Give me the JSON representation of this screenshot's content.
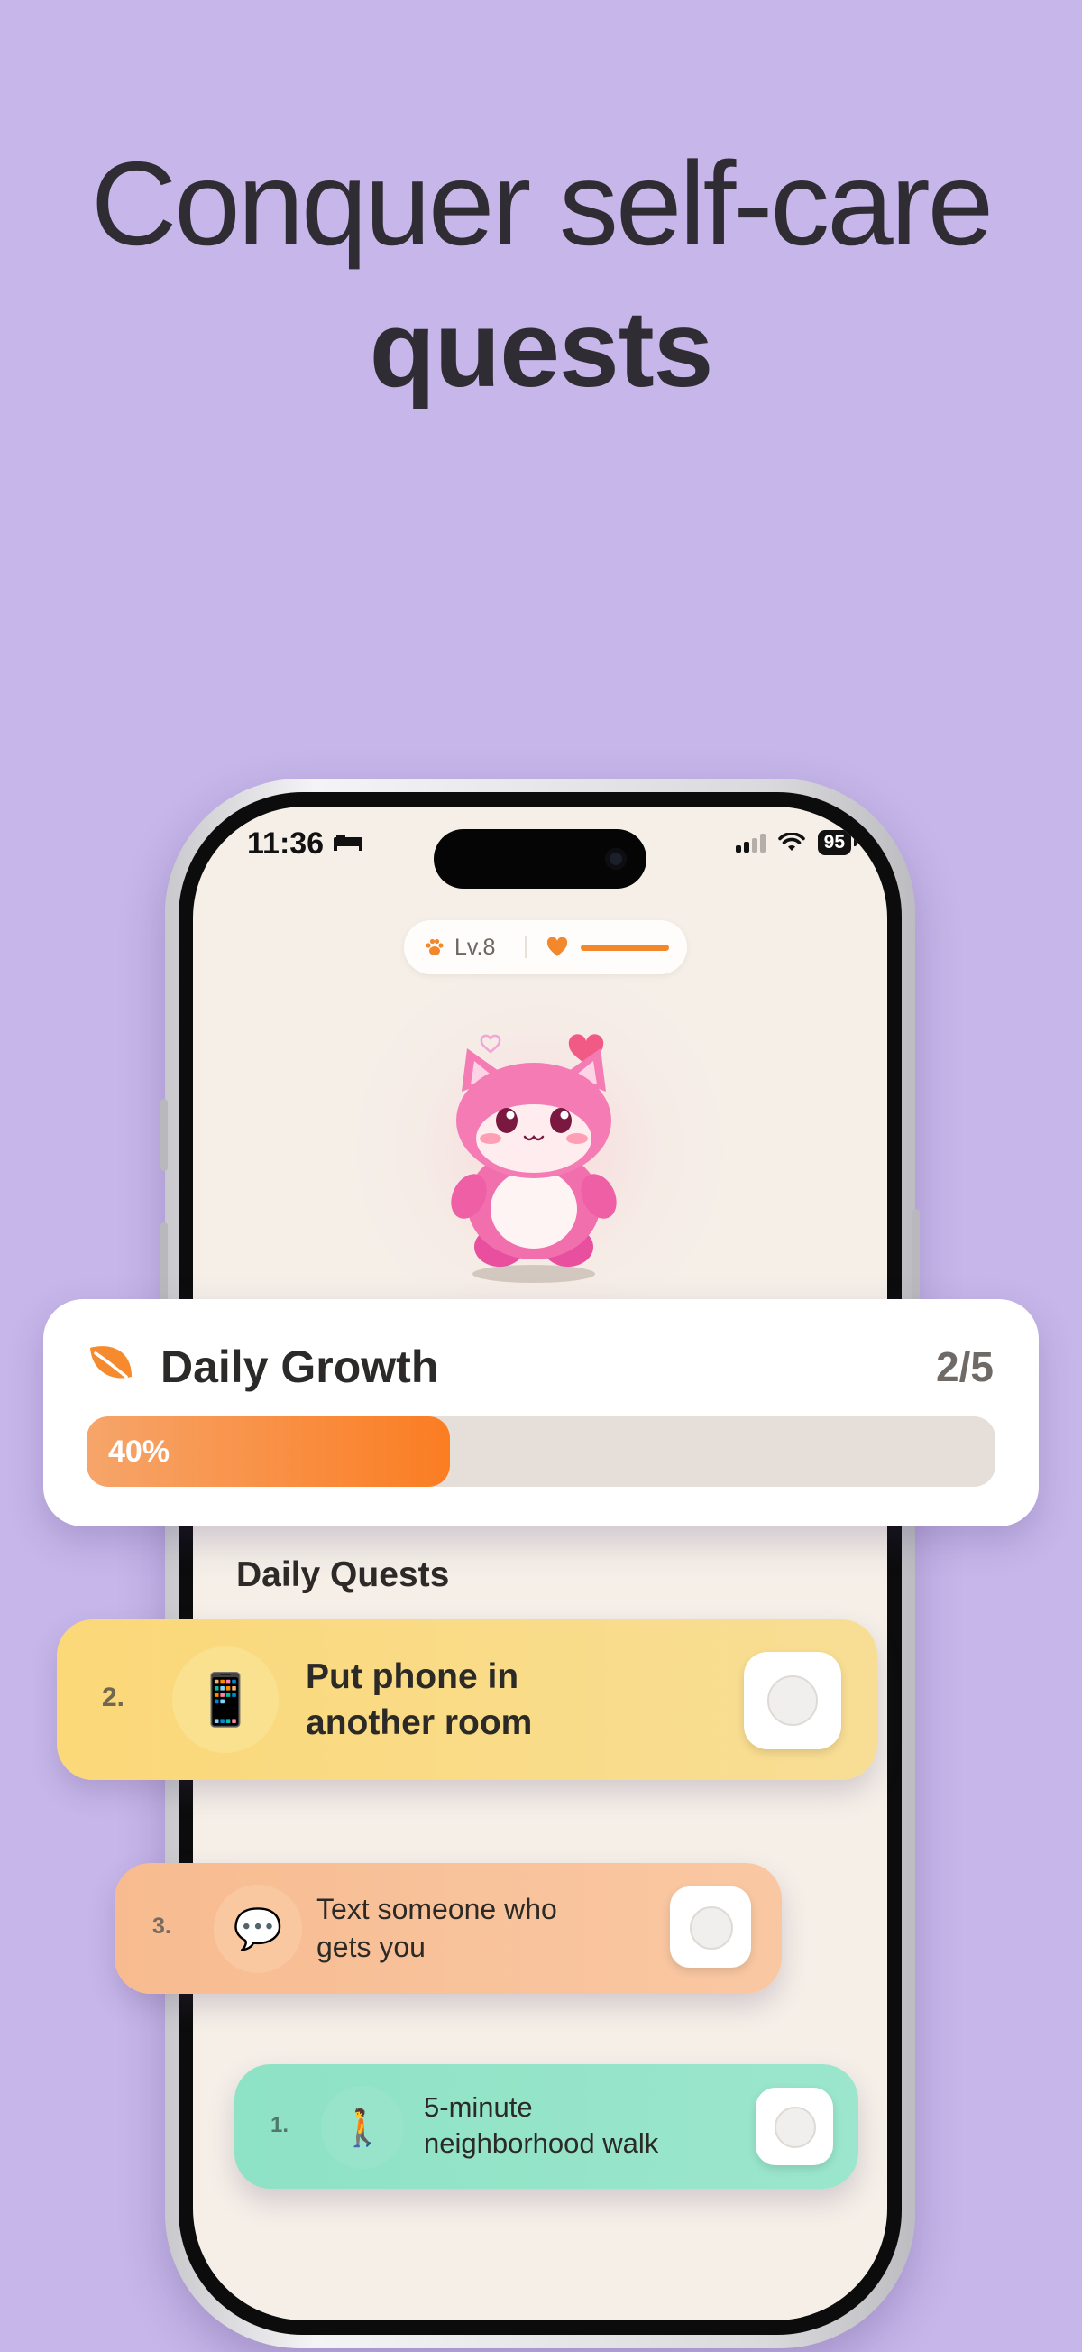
{
  "headline": {
    "line1": "Conquer self-care",
    "line2": "quests"
  },
  "status_bar": {
    "time": "11:36",
    "battery": "95"
  },
  "pet_status": {
    "level": "Lv.8",
    "mood_level": 1.0
  },
  "daily_growth": {
    "title": "Daily Growth",
    "count": "2/5",
    "percent_label": "40%",
    "progress": 0.4
  },
  "daily_quests": {
    "title": "Daily Quests",
    "items": [
      {
        "number": "2.",
        "emoji": "📱",
        "label_line1": "Put phone in",
        "label_line2": "another room",
        "done": false
      },
      {
        "number": "3.",
        "emoji": "💬",
        "label_line1": "Text someone who",
        "label_line2": "gets you",
        "done": false
      },
      {
        "number": "1.",
        "emoji": "🚶",
        "label_line1": "5-minute",
        "label_line2": "neighborhood walk",
        "done": false
      }
    ]
  },
  "colors": {
    "background": "#c6b6ea",
    "accent": "#fb7d22",
    "quest_yellow": "#fbd878",
    "quest_peach": "#f8bb90",
    "quest_mint": "#8ee2c5"
  }
}
